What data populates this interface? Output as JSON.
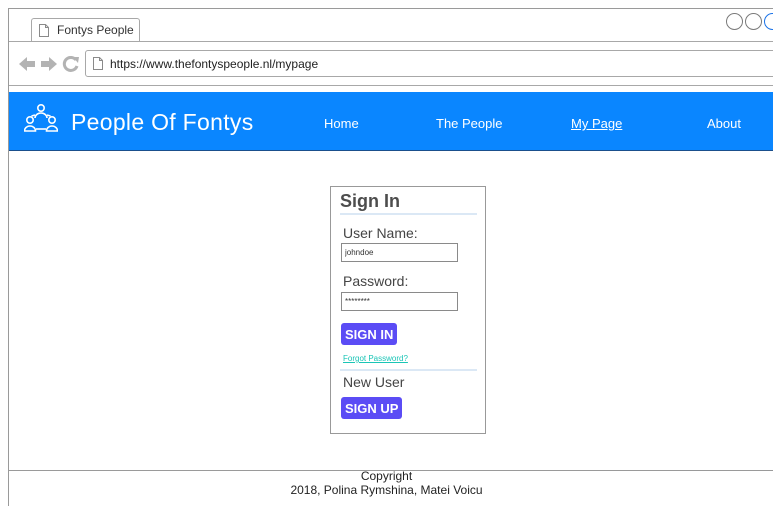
{
  "browser": {
    "tab_title": "Fontys People",
    "url": "https://www.thefontyspeople.nl/mypage"
  },
  "header": {
    "site_title": "People Of Fontys",
    "nav": [
      {
        "label": "Home",
        "active": false
      },
      {
        "label": "The People",
        "active": false
      },
      {
        "label": "My Page",
        "active": true
      },
      {
        "label": "About",
        "active": false
      }
    ]
  },
  "signin": {
    "heading": "Sign In",
    "username_label": "User Name:",
    "username_value": "johndoe",
    "password_label": "Password:",
    "password_value": "********",
    "signin_button": "SIGN IN",
    "forgot_link": "Forgot Password?",
    "newuser_heading": "New User",
    "signup_button": "SIGN UP"
  },
  "footer": {
    "line1": "Copyright",
    "line2": "2018, Polina Rymshina, Matei Voicu"
  },
  "colors": {
    "header_bg": "#0a86ff",
    "button_bg": "#5b4cf5",
    "link_color": "#1ac5b6"
  },
  "icons": [
    "page-icon",
    "back-arrow-icon",
    "forward-arrow-icon",
    "reload-icon",
    "people-group-icon"
  ]
}
